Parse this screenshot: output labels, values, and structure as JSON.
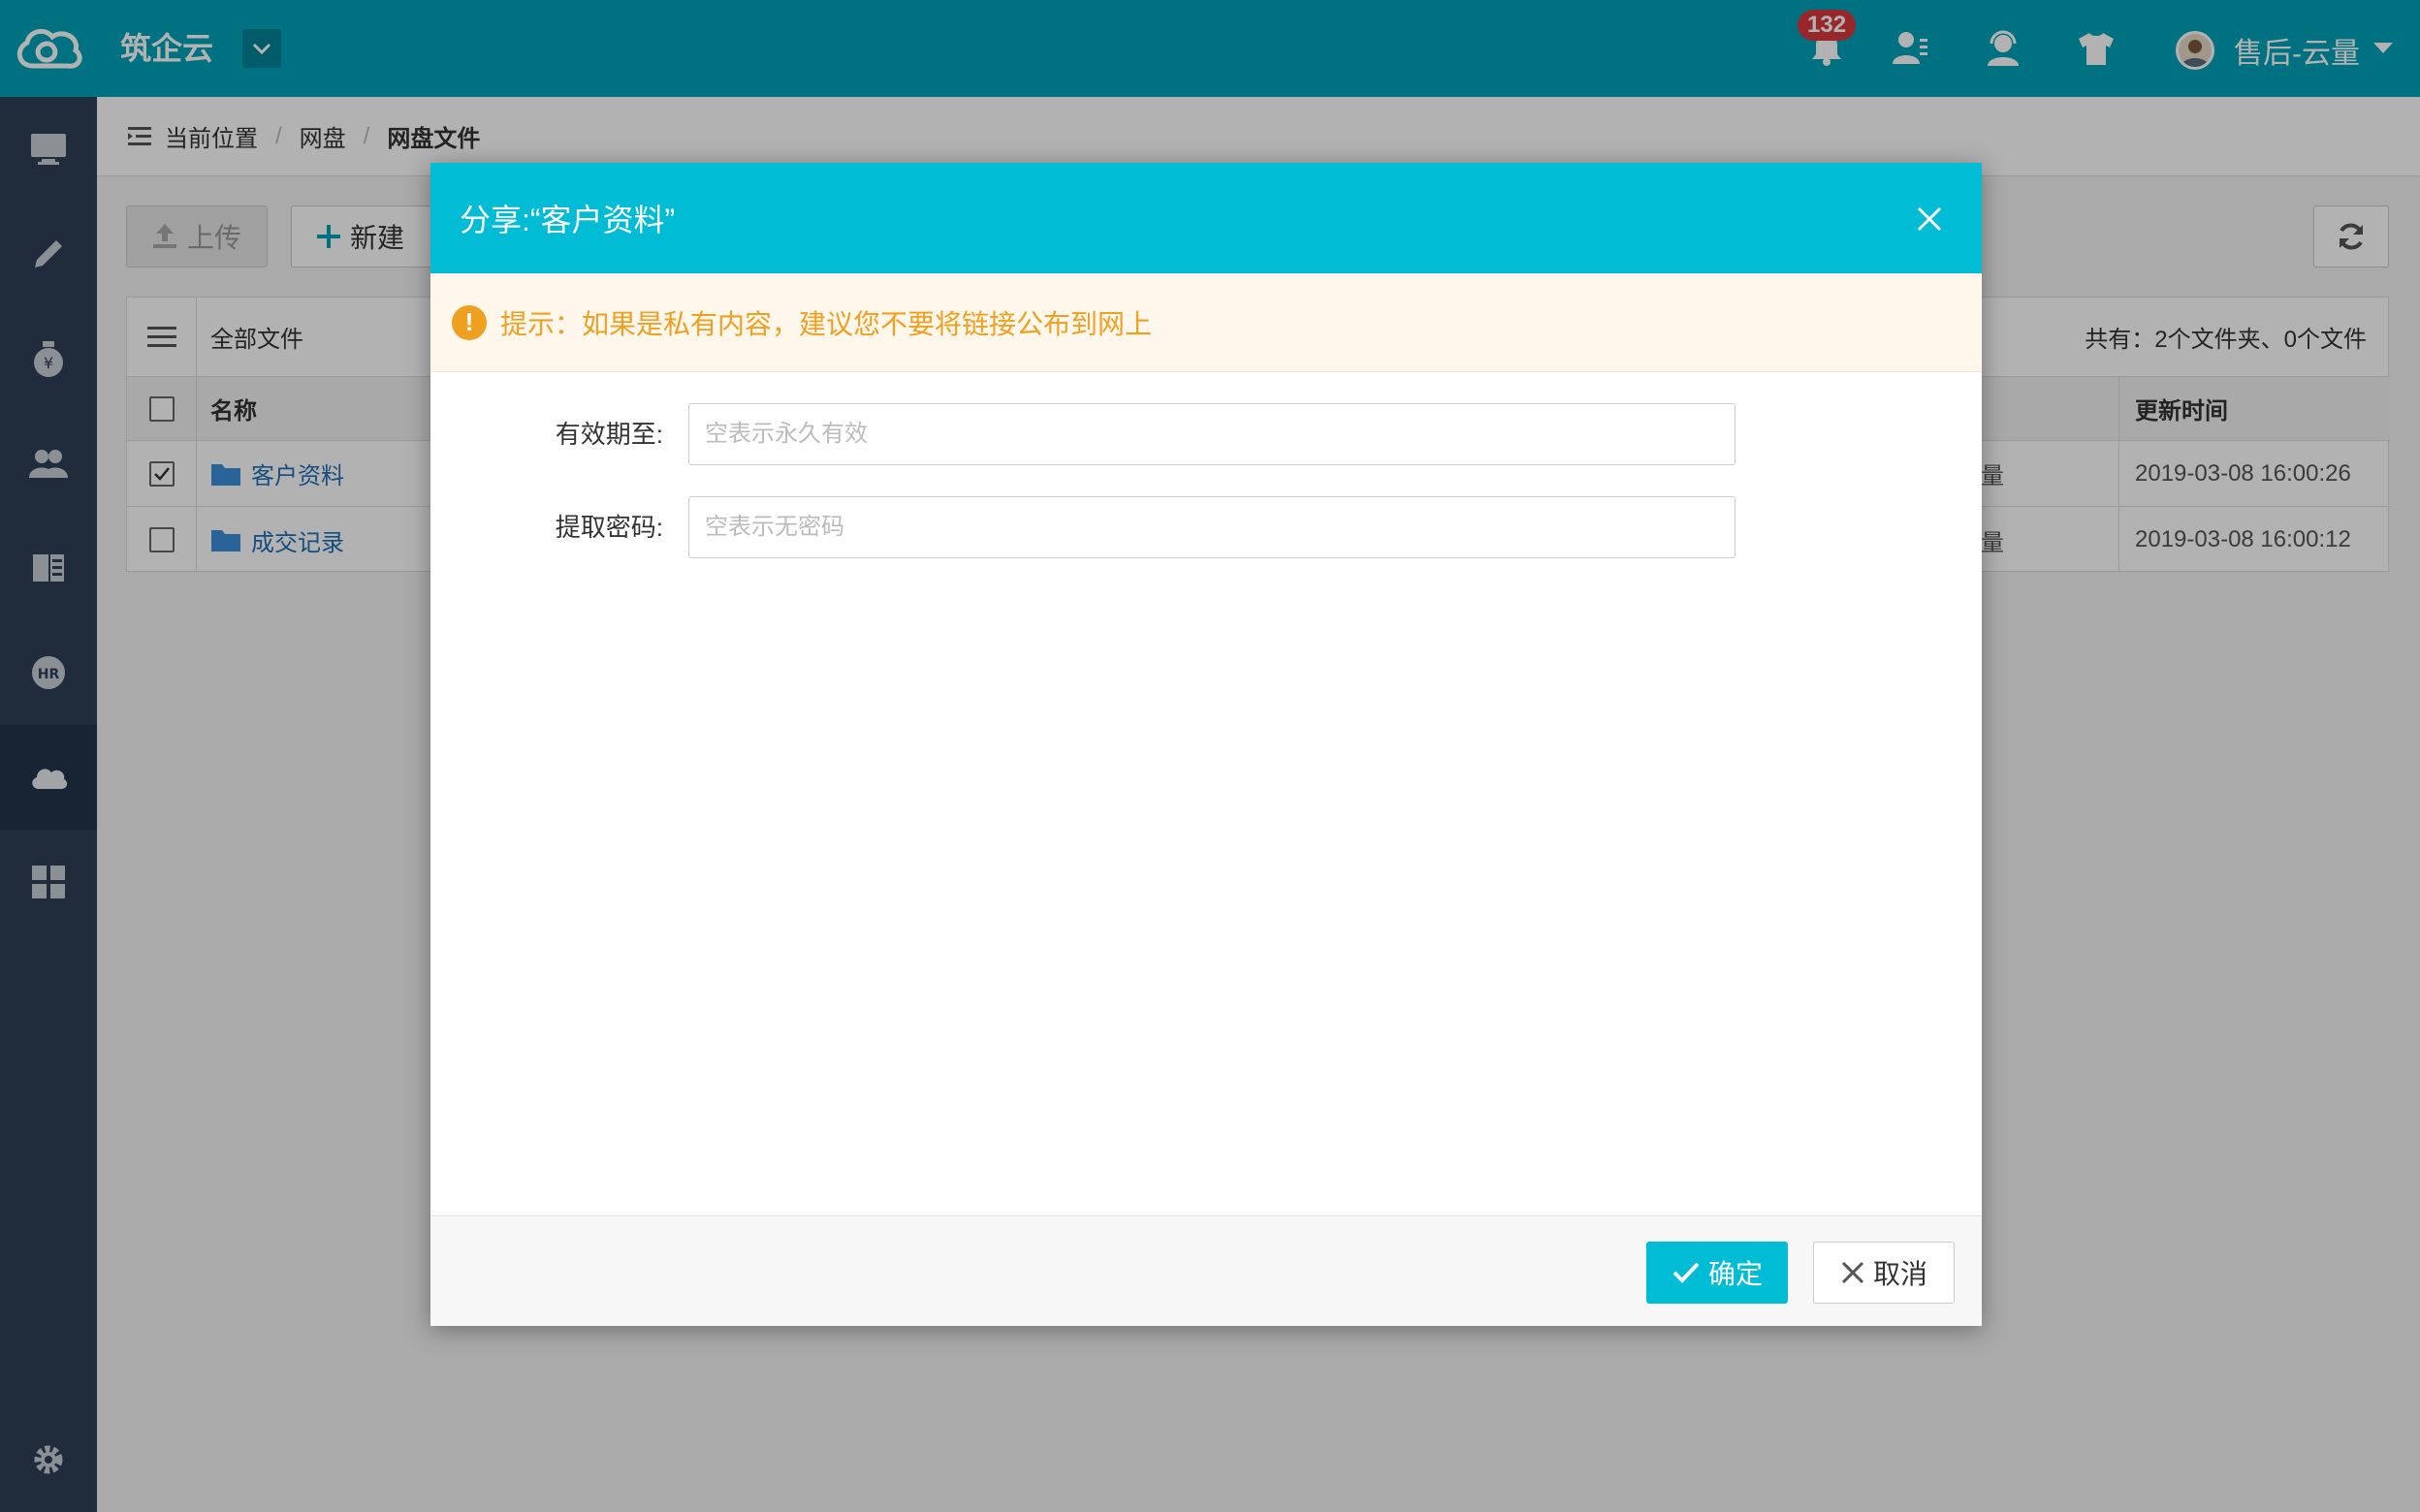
{
  "app": {
    "brand": "筑企云",
    "notification_count": "132",
    "user_name": "售后-云量",
    "accent_color": "#00a3b8",
    "sidebar_color": "#2f4056"
  },
  "top_icons": [
    "bell-icon",
    "contacts-icon",
    "support-icon",
    "tshirt-icon"
  ],
  "sidebar": {
    "items": [
      {
        "icon": "desktop-icon"
      },
      {
        "icon": "pencil-icon"
      },
      {
        "icon": "money-bag-icon"
      },
      {
        "icon": "people-icon"
      },
      {
        "icon": "ok-book-icon"
      },
      {
        "icon": "hr-icon"
      },
      {
        "icon": "cloud-icon",
        "active": true
      },
      {
        "icon": "grid-icon"
      },
      {
        "icon": "gear-icon"
      }
    ]
  },
  "breadcrumb": {
    "label": "当前位置",
    "items": [
      "网盘",
      "网盘文件"
    ]
  },
  "toolbar": {
    "upload_label": "上传",
    "new_label": "新建"
  },
  "file_table": {
    "root_label": "全部文件",
    "summary": "共有：2个文件夹、0个文件",
    "headers": {
      "name": "名称",
      "time": "更新时间"
    },
    "rows": [
      {
        "name": "客户资料",
        "owner": "量",
        "time": "2019-03-08 16:00:26",
        "checked": true
      },
      {
        "name": "成交记录",
        "owner": "量",
        "time": "2019-03-08 16:00:12",
        "checked": false
      }
    ]
  },
  "modal": {
    "title": "分享:“客户资料”",
    "alert": "提示：如果是私有内容，建议您不要将链接公布到网上",
    "fields": {
      "expire_label": "有效期至:",
      "expire_placeholder": "空表示永久有效",
      "password_label": "提取密码:",
      "password_placeholder": "空表示无密码"
    },
    "confirm_label": "确定",
    "cancel_label": "取消"
  }
}
